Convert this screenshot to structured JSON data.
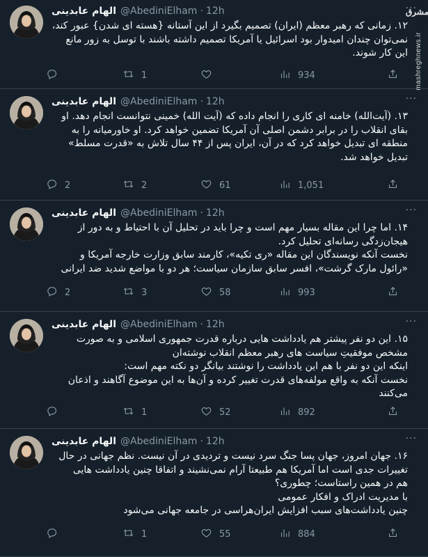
{
  "watermark": {
    "logo_text": "مشرق",
    "site": "mashreghnews.ir"
  },
  "tweets": [
    {
      "name": "الهام عابدینی",
      "handle": "@AbediniElham",
      "sep": "·",
      "time": "12h",
      "more": "···",
      "lines": [
        "۱۲. زمانی که رهبر معظم (ایران) تصمیم بگیرد از این آستانه {هسته ای شدن} عبور کند،",
        "نمی‌توان چندان امیدوار بود اسرائیل یا آمریکا تصمیم داشته باشند با توسل به زور مانع",
        "این کار شوند."
      ],
      "replies": "",
      "retweets": "1",
      "likes": "",
      "views": "934"
    },
    {
      "name": "الهام عابدینی",
      "handle": "@AbediniElham",
      "sep": "·",
      "time": "12h",
      "more": "···",
      "lines": [
        "۱۳. (آیت‌الله) خامنه ای کاری را انجام داده که (آیت الله) خمینی نتوانست انجام دهد. او",
        "بقای انقلاب را در برابر دشمن اصلی آن آمریکا تضمین خواهد کرد. او خاورمیانه را به",
        "منطقه ای تبدیل خواهد کرد که در آن، ایران پس از ۴۴ سال تلاش به «قدرت مسلط»",
        "تبدیل خواهد شد."
      ],
      "replies": "2",
      "retweets": "2",
      "likes": "61",
      "views": "1,051"
    },
    {
      "name": "الهام عابدینی",
      "handle": "@AbediniElham",
      "sep": "·",
      "time": "12h",
      "more": "···",
      "lines": [
        "۱۴. اما چرا این مقاله بسیار مهم است و چرا باید در تحلیل آن با احتیاط و به دور از",
        "هیجان‌زدگی رسانه‌ای تحلیل کرد.",
        "نخست آنکه نویسندگان این مقاله «ری تکیه»، کارمند سابق وزارت خارجه آمریکا و",
        "«رائول مارک گرشت»، افسر سابق سازمان سیاست؛ هر دو با مواضع شدید ضد ایرانی"
      ],
      "replies": "2",
      "retweets": "3",
      "likes": "58",
      "views": "993"
    },
    {
      "name": "الهام عابدینی",
      "handle": "@AbediniElham",
      "sep": "·",
      "time": "12h",
      "more": "···",
      "lines": [
        "۱۵. این دو نفر پیشتر هم یادداشت هایی درباره قدرت جمهوری اسلامی و به صورت",
        "مشخص موفقیتِ سیاست های رهبر معظم انقلاب نوشته‌ان",
        "اینکه این دو نفر با هم این یادداشت را نوشتند بیانگر دو نکته مهم است:",
        "نخست آنکه به واقع مولفه‌های قدرت تغییر کرده و آن‌ها به این موضوع آگاهند و اذعان",
        "می‌کنند"
      ],
      "replies": "",
      "retweets": "1",
      "likes": "52",
      "views": "892"
    },
    {
      "name": "الهام عابدینی",
      "handle": "@AbediniElham",
      "sep": "·",
      "time": "12h",
      "more": "···",
      "lines": [
        "۱۶. جهان امروز، جهان پسا جنگ سرد نیست و تردیدی در آن نیست. نظم جهانی در حال",
        "تغییرات جدی است اما آمریکا هم طبیعتا آرام نمی‌نشیند و اتفاقا چنین یادداشت هایی",
        "هم در همین راستاست؛ چطوری؟",
        "با مدیریت ادراک و افکار عمومی",
        "چنین یادداشت‌های سبب افزایش ایران‌هراسی در جامعه جهانی می‌شود"
      ],
      "replies": "",
      "retweets": "1",
      "likes": "55",
      "views": "884"
    }
  ]
}
